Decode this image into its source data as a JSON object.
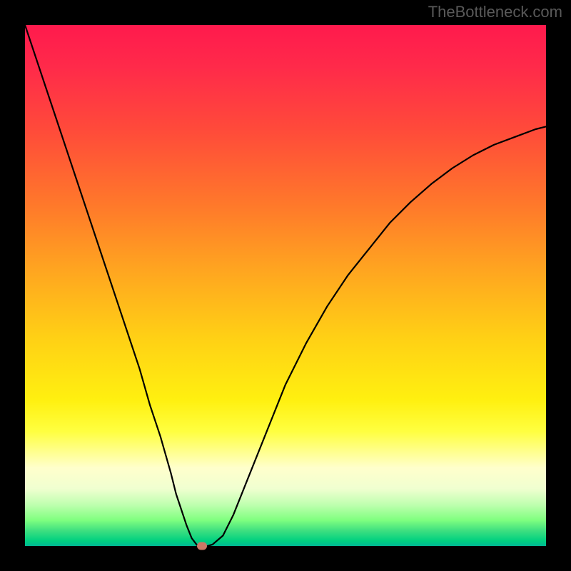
{
  "watermark": "TheBottleneck.com",
  "colors": {
    "background": "#000000",
    "gradient_top": "#ff1a4d",
    "gradient_mid": "#ffd015",
    "gradient_bottom": "#00b894",
    "curve": "#000000",
    "marker": "#cc7766"
  },
  "chart_data": {
    "type": "line",
    "title": "",
    "xlabel": "",
    "ylabel": "",
    "xlim": [
      0,
      100
    ],
    "ylim": [
      0,
      100
    ],
    "x": [
      0,
      2,
      4,
      6,
      8,
      10,
      12,
      14,
      16,
      18,
      20,
      22,
      24,
      26,
      28,
      29,
      30,
      31,
      32,
      33,
      34,
      35,
      36,
      38,
      40,
      42,
      44,
      46,
      48,
      50,
      54,
      58,
      62,
      66,
      70,
      74,
      78,
      82,
      86,
      90,
      94,
      98,
      100
    ],
    "values": [
      100,
      94,
      88,
      82,
      76,
      70,
      64,
      58,
      52,
      46,
      40,
      34,
      27,
      21,
      14,
      10,
      7,
      4,
      1.5,
      0.2,
      0,
      0,
      0.3,
      2,
      6,
      11,
      16,
      21,
      26,
      31,
      39,
      46,
      52,
      57,
      62,
      66,
      69.5,
      72.5,
      75,
      77,
      78.5,
      80,
      80.5
    ],
    "marker": {
      "x": 34,
      "y": 0
    },
    "annotations": []
  }
}
